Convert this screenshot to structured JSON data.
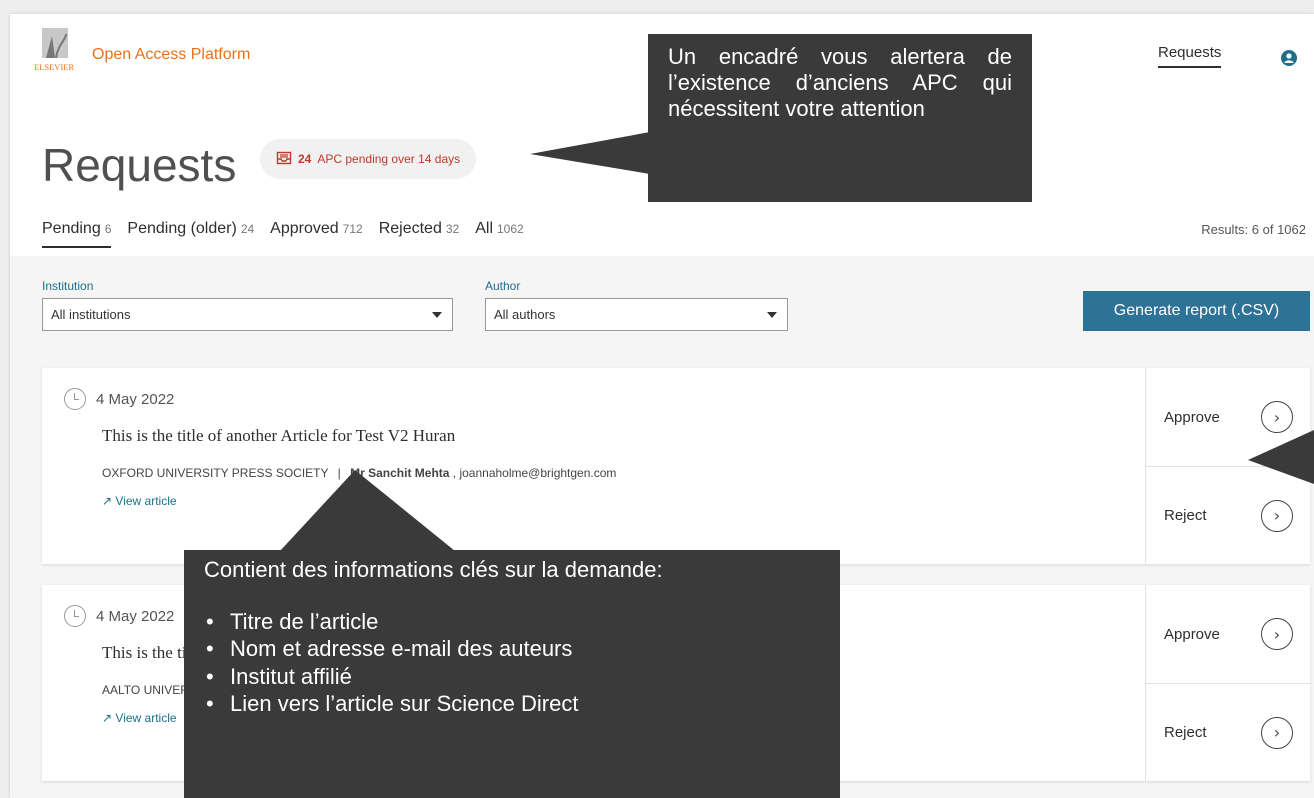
{
  "header": {
    "logo_text": "ELSEVIER",
    "brand": "Open Access Platform",
    "nav_requests": "Requests"
  },
  "page_title": "Requests",
  "badge": {
    "count": "24",
    "text": "APC pending over 14 days"
  },
  "tabs": [
    {
      "label": "Pending",
      "count": "6"
    },
    {
      "label": "Pending (older)",
      "count": "24"
    },
    {
      "label": "Approved",
      "count": "712"
    },
    {
      "label": "Rejected",
      "count": "32"
    },
    {
      "label": "All",
      "count": "1062"
    }
  ],
  "results": "Results: 6 of 1062",
  "filters": {
    "institution_label": "Institution",
    "institution_value": "All institutions",
    "author_label": "Author",
    "author_value": "All authors"
  },
  "generate_button": "Generate report (.CSV)",
  "cards": [
    {
      "date": "4 May 2022",
      "title": "This is the title of another Article for Test V2 Huran",
      "publisher": "OXFORD UNIVERSITY PRESS SOCIETY",
      "author": "Mr Sanchit Mehta",
      "email": ", joannaholme@brightgen.com",
      "link": "View article",
      "approve": "Approve",
      "reject": "Reject"
    },
    {
      "date": "4 May 2022",
      "title": "This is the title",
      "publisher": "AALTO UNIVERSITY",
      "link": "View article",
      "approve": "Approve",
      "reject": "Reject"
    }
  ],
  "callouts": {
    "alert": "Un encadré vous alertera de l’existence d’anciens APC qui nécessitent votre attention",
    "info_heading": "Contient des informations clés sur la demande:",
    "info_items": [
      "Titre de l’article",
      "Nom et adresse e-mail des auteurs",
      "Institut affilié",
      "Lien vers l’article sur Science Direct"
    ]
  },
  "colors": {
    "brand_orange": "#e9711c",
    "primary_blue": "#2d7397",
    "badge_red": "#c0392b",
    "callout_bg": "#3a3a3a"
  }
}
